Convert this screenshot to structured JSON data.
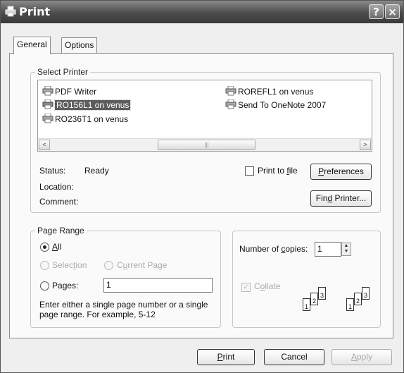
{
  "window": {
    "title": "Print",
    "help_button": "?",
    "close_button": "×"
  },
  "tabs": [
    {
      "label": "General"
    },
    {
      "label": "Options"
    }
  ],
  "select_printer": {
    "group_label": "Select Printer",
    "printers": [
      {
        "name": "PDF Writer",
        "selected": false
      },
      {
        "name": "RO156L1 on venus",
        "selected": true
      },
      {
        "name": "RO236T1 on venus",
        "selected": false
      },
      {
        "name": "ROREFL1 on venus",
        "selected": false
      },
      {
        "name": "Send To OneNote 2007",
        "selected": false
      }
    ],
    "scroll_left": "<",
    "scroll_right": ">",
    "status_label": "Status:",
    "status_value": "Ready",
    "location_label": "Location:",
    "comment_label": "Comment:",
    "print_to_file_prefix": "Print to ",
    "print_to_file_mnemonic": "f",
    "print_to_file_suffix": "ile",
    "preferences_mnemonic": "P",
    "preferences_rest": "references",
    "find_printer_prefix": "Fin",
    "find_printer_mnemonic": "d",
    "find_printer_suffix": " Printer..."
  },
  "page_range": {
    "group_label": "Page Range",
    "all_mnemonic": "A",
    "all_rest": "ll",
    "selection_prefix": "Selec",
    "selection_mnemonic": "t",
    "selection_suffix": "ion",
    "current_prefix": "C",
    "current_mnemonic": "u",
    "current_suffix": "rrent Page",
    "pages_prefix": "Pa",
    "pages_mnemonic": "g",
    "pages_suffix": "es:",
    "pages_value": "1",
    "help_line1": "Enter either a single page number or a single",
    "help_line2": "page range.  For example, 5-12"
  },
  "copies": {
    "number_prefix": "Number of ",
    "number_mnemonic": "c",
    "number_suffix": "opies:",
    "value": "1",
    "collate_prefix": "C",
    "collate_mnemonic": "o",
    "collate_suffix": "llate",
    "collate_checked": true,
    "collate_enabled": false,
    "stack_pages": [
      "1",
      "2",
      "3"
    ]
  },
  "buttons": {
    "print_mnemonic": "P",
    "print_rest": "rint",
    "cancel": "Cancel",
    "apply_mnemonic": "A",
    "apply_rest": "pply"
  }
}
